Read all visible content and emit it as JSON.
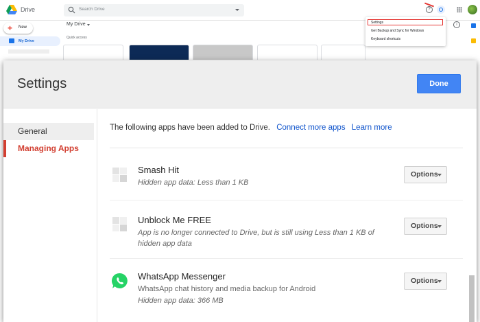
{
  "drive": {
    "app_name": "Drive",
    "search_placeholder": "Search Drive",
    "new_label": "New",
    "nav_my_drive": "My Drive",
    "breadcrumb": "My Drive",
    "quick_access": "Quick access",
    "help_glyph": "?",
    "info_glyph": "i"
  },
  "gear_menu": {
    "items": [
      "Settings",
      "Get Backup and Sync for Windows",
      "Keyboard shortcuts"
    ]
  },
  "settings": {
    "title": "Settings",
    "done_label": "Done",
    "nav": [
      "General",
      "Managing Apps"
    ],
    "intro": "The following apps have been added to Drive.",
    "connect_more": "Connect more apps",
    "learn_more": "Learn more",
    "options_label": "Options",
    "apps": [
      {
        "name": "Smash Hit",
        "desc": "Hidden app data: Less than 1 KB"
      },
      {
        "name": "Unblock Me FREE",
        "desc": "App is no longer connected to Drive, but is still using Less than 1 KB of hidden app data"
      },
      {
        "name": "WhatsApp Messenger",
        "desc": "WhatsApp chat history and media backup for Android",
        "desc2": "Hidden app data: 366 MB"
      }
    ]
  },
  "colors": {
    "accent_blue": "#4285f4",
    "link_blue": "#1155cc",
    "active_red": "#d23f31",
    "whatsapp_green": "#25d366"
  }
}
